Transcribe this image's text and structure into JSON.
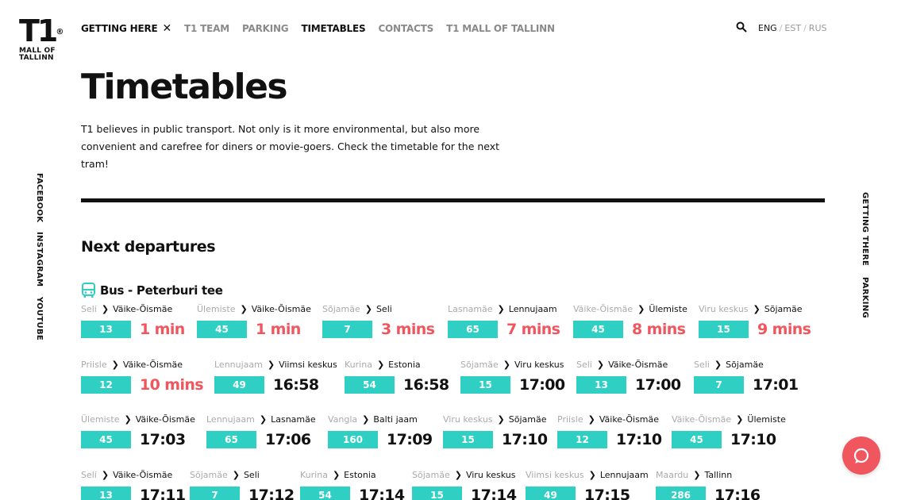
{
  "brand": {
    "mark": "T1",
    "reg": "®",
    "line1": "MALL OF",
    "line2": "TALLINN"
  },
  "nav": [
    {
      "label": "GETTING HERE",
      "close": "✕"
    },
    {
      "label": "T1 TEAM"
    },
    {
      "label": "PARKING"
    },
    {
      "label": "TIMETABLES"
    },
    {
      "label": "CONTACTS"
    },
    {
      "label": "T1 MALL OF TALLINN"
    }
  ],
  "languages": [
    "ENG",
    "EST",
    "RUS"
  ],
  "sep": "/",
  "social": [
    "FACEBOOK",
    "INSTAGRAM",
    "YOUTUBE"
  ],
  "side_right": [
    "GETTING THERE",
    "PARKING"
  ],
  "page_title": "Timetables",
  "intro": "T1 believes in public transport. Not only is it more environmental, but also more convenient and carefree for diners or movie-goers. Check the timetable for the next tram!",
  "section_title": "Next departures",
  "bus_label": "Bus - Peterburi tee",
  "colors": {
    "accent": "#2fd0c3",
    "alert": "#f0565e",
    "text": "#111111"
  },
  "rows": [
    [
      {
        "from": "Seli",
        "to": "Väike-Õismäe",
        "line": "13",
        "time": "1 min",
        "soon": true
      },
      {
        "from": "Ülemiste",
        "to": "Väike-Õismäe",
        "line": "45",
        "time": "1 min",
        "soon": true
      },
      {
        "from": "Sõjamäe",
        "to": "Seli",
        "line": "7",
        "time": "3 mins",
        "soon": true
      },
      {
        "from": "Lasnamäe",
        "to": "Lennujaam",
        "line": "65",
        "time": "7 mins",
        "soon": true
      },
      {
        "from": "Väike-Õismäe",
        "to": "Ülemiste",
        "line": "45",
        "time": "8 mins",
        "soon": true
      },
      {
        "from": "Viru keskus",
        "to": "Sõjamäe",
        "line": "15",
        "time": "9 mins",
        "soon": true
      }
    ],
    [
      {
        "from": "Priisle",
        "to": "Väike-Õismäe",
        "line": "12",
        "time": "10 mins",
        "soon": true
      },
      {
        "from": "Lennujaam",
        "to": "Viimsi keskus",
        "line": "49",
        "time": "16:58",
        "soon": false
      },
      {
        "from": "Kurina",
        "to": "Estonia",
        "line": "54",
        "time": "16:58",
        "soon": false
      },
      {
        "from": "Sõjamäe",
        "to": "Viru keskus",
        "line": "15",
        "time": "17:00",
        "soon": false
      },
      {
        "from": "Seli",
        "to": "Väike-Õismäe",
        "line": "13",
        "time": "17:00",
        "soon": false
      },
      {
        "from": "Seli",
        "to": "Sõjamäe",
        "line": "7",
        "time": "17:01",
        "soon": false
      }
    ],
    [
      {
        "from": "Ülemiste",
        "to": "Väike-Õismäe",
        "line": "45",
        "time": "17:03",
        "soon": false
      },
      {
        "from": "Lennujaam",
        "to": "Lasnamäe",
        "line": "65",
        "time": "17:06",
        "soon": false
      },
      {
        "from": "Vangla",
        "to": "Balti jaam",
        "line": "160",
        "time": "17:09",
        "soon": false
      },
      {
        "from": "Viru keskus",
        "to": "Sõjamäe",
        "line": "15",
        "time": "17:10",
        "soon": false
      },
      {
        "from": "Priisle",
        "to": "Väike-Õismäe",
        "line": "12",
        "time": "17:10",
        "soon": false
      },
      {
        "from": "Väike-Õismäe",
        "to": "Ülemiste",
        "line": "45",
        "time": "17:10",
        "soon": false
      }
    ],
    [
      {
        "from": "Seli",
        "to": "Väike-Õismäe",
        "line": "13",
        "time": "17:11",
        "soon": false
      },
      {
        "from": "Sõjamäe",
        "to": "Seli",
        "line": "7",
        "time": "17:12",
        "soon": false
      },
      {
        "from": "Kurina",
        "to": "Estonia",
        "line": "54",
        "time": "17:14",
        "soon": false
      },
      {
        "from": "Sõjamäe",
        "to": "Viru keskus",
        "line": "15",
        "time": "17:14",
        "soon": false
      },
      {
        "from": "Viimsi keskus",
        "to": "Lennujaam",
        "line": "49",
        "time": "17:15",
        "soon": false
      },
      {
        "from": "Maardu",
        "to": "Tallinn",
        "line": "286",
        "time": "17:16",
        "soon": false
      }
    ]
  ]
}
